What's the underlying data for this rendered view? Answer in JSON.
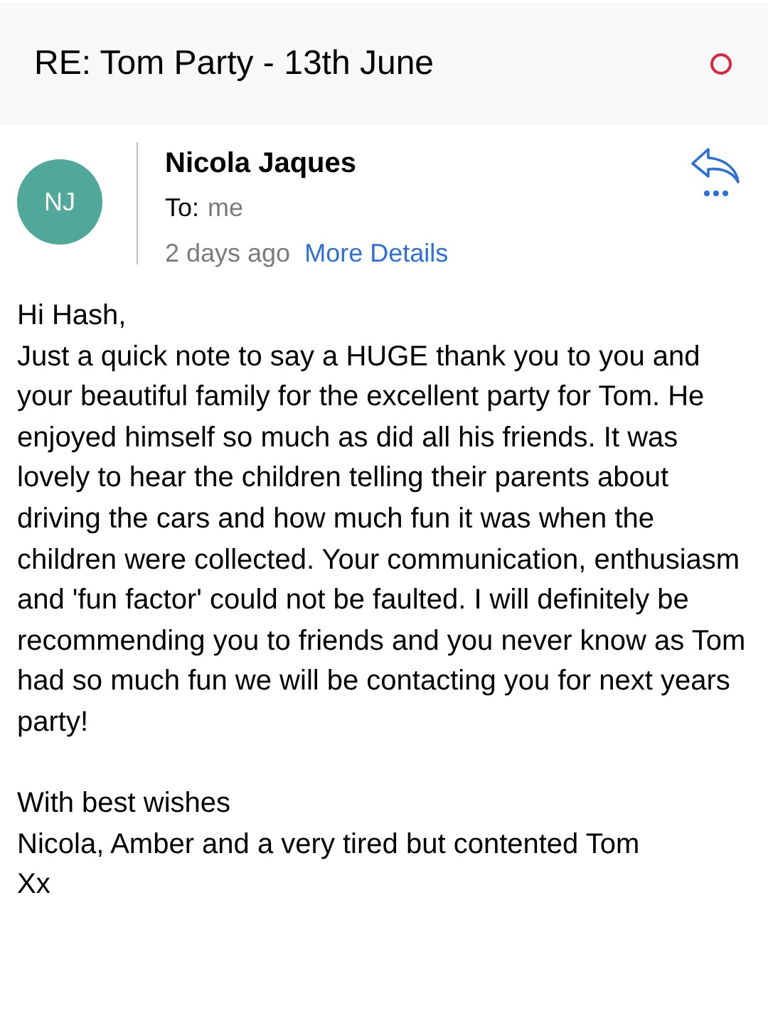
{
  "header": {
    "subject": "RE: Tom Party - 13th June"
  },
  "sender": {
    "initials": "NJ",
    "color": "#4fa89a",
    "name": "Nicola Jaques",
    "to_label": "To:",
    "to_value": "me",
    "time": "2 days ago",
    "details_link": "More Details"
  },
  "body": {
    "paragraphs": [
      "Hi Hash,",
      "Just a quick note to say a HUGE thank you to you and your beautiful family for the excellent party for Tom. He enjoyed himself so much as did all his friends. It was lovely to hear the children telling their parents about driving the cars and how much fun it was when the children were collected. Your communication, enthusiasm and 'fun factor' could not be faulted. I will definitely be recommending you to friends and you never know as Tom had so much fun we will be contacting you for next years party!"
    ],
    "closing": [
      "With best wishes",
      "Nicola, Amber and a very tired but contented Tom",
      "Xx"
    ]
  }
}
